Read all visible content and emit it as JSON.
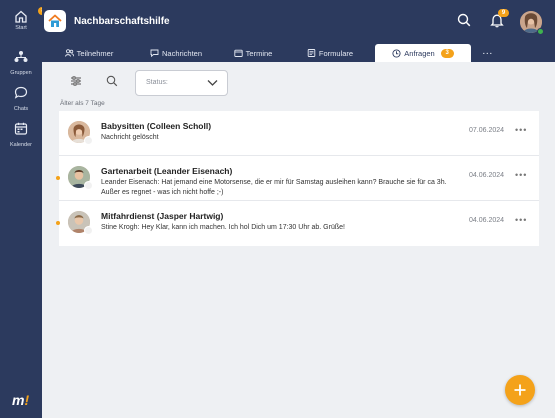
{
  "rail": {
    "items": [
      {
        "label": "Start",
        "icon": "home-icon",
        "badge": "8"
      },
      {
        "label": "Gruppen",
        "icon": "groups-icon"
      },
      {
        "label": "Chats",
        "icon": "chat-icon"
      },
      {
        "label": "Kalender",
        "icon": "calendar-icon"
      }
    ],
    "logo_text": "m!"
  },
  "header": {
    "title": "Nachbarschaftshilfe",
    "notification_badge": "9",
    "icons": [
      "search-icon",
      "bell-icon",
      "avatar"
    ]
  },
  "tabs": [
    {
      "label": "Teilnehmer",
      "icon": "people-icon"
    },
    {
      "label": "Nachrichten",
      "icon": "message-icon"
    },
    {
      "label": "Termine",
      "icon": "calendar-icon"
    },
    {
      "label": "Formulare",
      "icon": "form-icon"
    },
    {
      "label": "Anfragen",
      "icon": "request-icon",
      "count": "3",
      "active": true
    },
    {
      "label": "···",
      "icon": "more-icon"
    }
  ],
  "filters": {
    "status_placeholder": "Status:"
  },
  "section_label": "Älter als 7 Tage",
  "requests": [
    {
      "title": "Babysitten (Colleen Scholl)",
      "snippet": "Nachricht gelöscht",
      "date": "07.06.2024",
      "unread": false
    },
    {
      "title": "Gartenarbeit (Leander Eisenach)",
      "snippet": "Leander Eisenach: Hat jemand eine Motorsense, die er mir für Samstag ausleihen kann? Brauche sie für ca 3h. Außer es regnet - was ich nicht hoffe ;-)",
      "date": "04.06.2024",
      "unread": true
    },
    {
      "title": "Mitfahrdienst (Jasper Hartwig)",
      "snippet": "Stine Krogh: Hey Klar, kann ich machen. Ich hol Dich um 17:30 Uhr ab. Grüße!",
      "date": "04.06.2024",
      "unread": true
    }
  ],
  "colors": {
    "navy": "#2c3a5e",
    "accent": "#f4a21a",
    "background": "#eef0f3"
  }
}
